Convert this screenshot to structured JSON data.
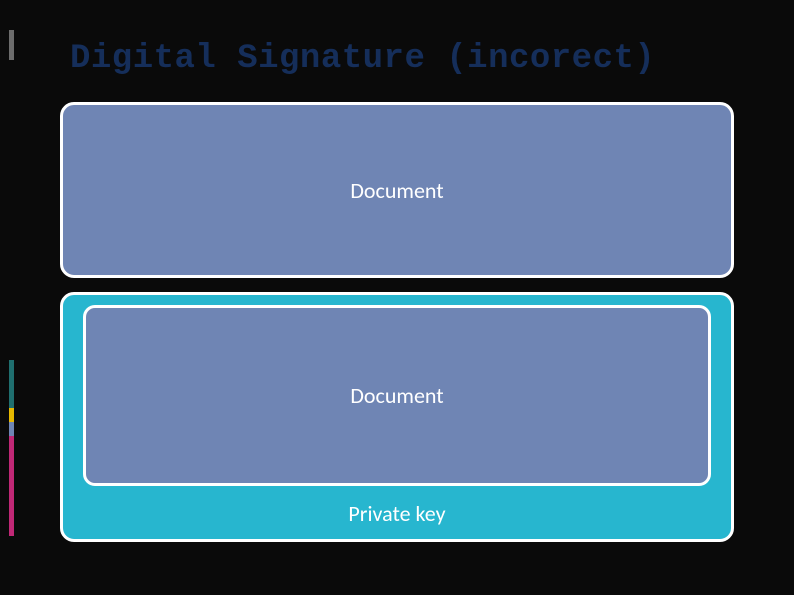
{
  "title": "Digital Signature (incorect)",
  "boxes": {
    "top": {
      "label": "Document"
    },
    "bottom": {
      "inner_label": "Document",
      "footer_label": "Private key"
    }
  },
  "colors": {
    "background": "#0a0a0a",
    "title": "#152e5a",
    "box_top": "#6f85b4",
    "box_bottom": "#27b6cf",
    "border": "#ffffff"
  }
}
